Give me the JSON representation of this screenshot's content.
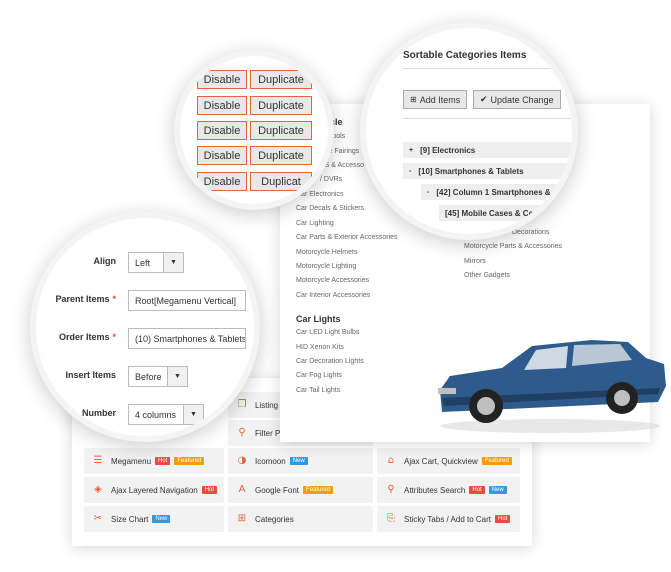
{
  "features": [
    {
      "label": "Listing",
      "icon": "listing-icon",
      "glyph": "❐",
      "badges": []
    },
    {
      "label": "Filter P",
      "icon": "filter-icon",
      "glyph": "⚲",
      "badges": []
    },
    {
      "label": "Megamenu",
      "icon": "menu-icon",
      "glyph": "☰",
      "badges": [
        {
          "text": "Hot",
          "type": "hot"
        },
        {
          "text": "Featured",
          "type": "featured"
        }
      ]
    },
    {
      "label": "Icomoon",
      "icon": "icomoon-icon",
      "glyph": "◑",
      "badges": [
        {
          "text": "New",
          "type": "new"
        }
      ]
    },
    {
      "label": "Ajax Cart, Quickview",
      "icon": "cart-icon",
      "glyph": "⌂",
      "badges": [
        {
          "text": "Featured",
          "type": "featured"
        }
      ]
    },
    {
      "label": "Ajax Layered Navigation",
      "icon": "layers-icon",
      "glyph": "◈",
      "badges": [
        {
          "text": "Hot",
          "type": "hot"
        }
      ]
    },
    {
      "label": "Google Font",
      "icon": "font-icon",
      "glyph": "A",
      "badges": [
        {
          "text": "Featured",
          "type": "featured"
        }
      ]
    },
    {
      "label": "Attributes Search",
      "icon": "search-icon",
      "glyph": "⚲",
      "badges": [
        {
          "text": "Hot",
          "type": "hot"
        },
        {
          "text": "New",
          "type": "new"
        }
      ]
    },
    {
      "label": "Size Chart",
      "icon": "size-chart-icon",
      "glyph": "✂",
      "badges": [
        {
          "text": "New",
          "type": "new"
        }
      ]
    },
    {
      "label": "Categories",
      "icon": "categories-icon",
      "glyph": "⊞",
      "badges": []
    },
    {
      "label": "Sticky Tabs / Add to Cart",
      "icon": "sticky-tabs-icon",
      "glyph": "⎘",
      "badges": [
        {
          "text": "Hot",
          "type": "hot"
        }
      ]
    }
  ],
  "category_panel": {
    "col1_head": "cycle",
    "col1_links": [
      "tic Tools",
      "ycle Fairings",
      "PS & Accesso",
      "/ DVRs",
      "Car Electronics",
      "Car Decals & Stickers",
      "Car Lighting",
      "Car Parts & Exterior Accessories",
      "Motorcycle Helmets",
      "Motorcycle Lighting",
      "Motorcycle Accessories",
      "Car Interior Accessories"
    ],
    "col2_links": [
      "Decorations",
      "Motorcycle Parts & Accessories",
      "Mirrors",
      "Other Gadgets"
    ],
    "section2_head": "Car Lights",
    "section2_links": [
      "Car LED Light Bulbs",
      "HID Xenon Kits",
      "Car Decoration Lights",
      "Car Fog Lights",
      "Car Tail Lights"
    ]
  },
  "actions_circle": {
    "disable_label": "Disable",
    "duplicate_label": "Duplicate",
    "partial_duplicate": "Duplicat",
    "row_count": 5
  },
  "sortable": {
    "title": "Sortable Categories Items",
    "add_items_label": "Add Items",
    "update_change_label": "Update Change",
    "tree": [
      {
        "label": "[9] Electronics",
        "level": 0,
        "caret": "+"
      },
      {
        "label": "[10] Smartphones & Tablets",
        "level": 0,
        "caret": "-"
      },
      {
        "label": "[42] Column 1 Smartphones &",
        "level": 1,
        "caret": "-"
      },
      {
        "label": "[45] Mobile Cases & Co",
        "level": 2,
        "caret": ""
      }
    ]
  },
  "form": {
    "align_label": "Align",
    "align_value": "Left",
    "parent_items_label": "Parent Items",
    "parent_items_value": "Root[Megamenu Vertical]",
    "order_items_label": "Order Items",
    "order_items_value": "(10) Smartphones & Tablets",
    "insert_items_label": "Insert Items",
    "insert_items_value": "Before",
    "number_label": "Number",
    "number_value": "4 columns"
  },
  "colors": {
    "accent": "#e8603c",
    "hot": "#e74c3c",
    "new": "#3498db",
    "featured": "#f39c12",
    "car_body": "#2f5b8c"
  }
}
